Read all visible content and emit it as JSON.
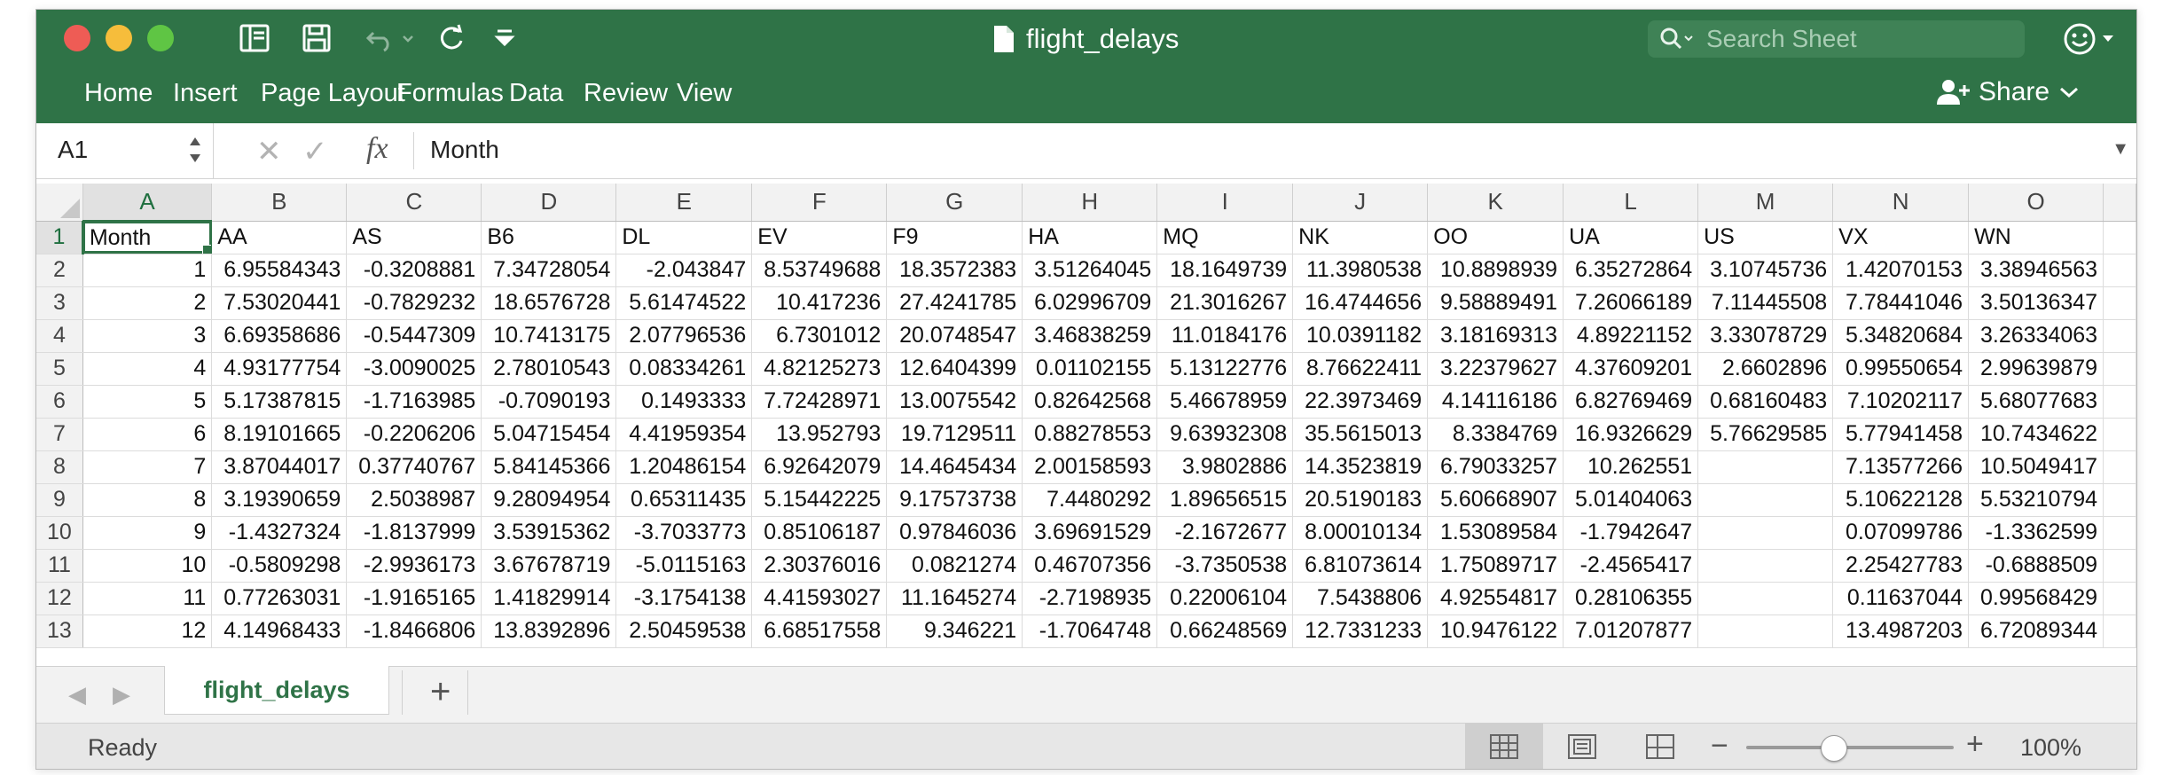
{
  "titlebar": {
    "doc_title": "flight_delays",
    "search_placeholder": "Search Sheet"
  },
  "ribbon": {
    "tabs": [
      "Home",
      "Insert",
      "Page Layout",
      "Formulas",
      "Data",
      "Review",
      "View"
    ],
    "share_label": "Share"
  },
  "formula_bar": {
    "cell_ref": "A1",
    "content": "Month"
  },
  "grid": {
    "columns": [
      "A",
      "B",
      "C",
      "D",
      "E",
      "F",
      "G",
      "H",
      "I",
      "J",
      "K",
      "L",
      "M",
      "N",
      "O"
    ],
    "rows": [
      {
        "num": "1",
        "cells": [
          "Month",
          "AA",
          "AS",
          "B6",
          "DL",
          "EV",
          "F9",
          "HA",
          "MQ",
          "NK",
          "OO",
          "UA",
          "US",
          "VX",
          "WN"
        ]
      },
      {
        "num": "2",
        "cells": [
          "1",
          "6.95584343",
          "-0.3208881",
          "7.34728054",
          "-2.043847",
          "8.53749688",
          "18.3572383",
          "3.51264045",
          "18.1649739",
          "11.3980538",
          "10.8898939",
          "6.35272864",
          "3.10745736",
          "1.42070153",
          "3.38946563"
        ]
      },
      {
        "num": "3",
        "cells": [
          "2",
          "7.53020441",
          "-0.7829232",
          "18.6576728",
          "5.61474522",
          "10.417236",
          "27.4241785",
          "6.02996709",
          "21.3016267",
          "16.4744656",
          "9.58889491",
          "7.26066189",
          "7.11445508",
          "7.78441046",
          "3.50136347"
        ]
      },
      {
        "num": "4",
        "cells": [
          "3",
          "6.69358686",
          "-0.5447309",
          "10.7413175",
          "2.07796536",
          "6.7301012",
          "20.0748547",
          "3.46838259",
          "11.0184176",
          "10.0391182",
          "3.18169313",
          "4.89221152",
          "3.33078729",
          "5.34820684",
          "3.26334063"
        ]
      },
      {
        "num": "5",
        "cells": [
          "4",
          "4.93177754",
          "-3.0090025",
          "2.78010543",
          "0.08334261",
          "4.82125273",
          "12.6404399",
          "0.01102155",
          "5.13122776",
          "8.76622411",
          "3.22379627",
          "4.37609201",
          "2.6602896",
          "0.99550654",
          "2.99639879"
        ]
      },
      {
        "num": "6",
        "cells": [
          "5",
          "5.17387815",
          "-1.7163985",
          "-0.7090193",
          "0.1493333",
          "7.72428971",
          "13.0075542",
          "0.82642568",
          "5.46678959",
          "22.3973469",
          "4.14116186",
          "6.82769469",
          "0.68160483",
          "7.10202117",
          "5.68077683"
        ]
      },
      {
        "num": "7",
        "cells": [
          "6",
          "8.19101665",
          "-0.2206206",
          "5.04715454",
          "4.41959354",
          "13.952793",
          "19.7129511",
          "0.88278553",
          "9.63932308",
          "35.5615013",
          "8.3384769",
          "16.9326629",
          "5.76629585",
          "5.77941458",
          "10.7434622"
        ]
      },
      {
        "num": "8",
        "cells": [
          "7",
          "3.87044017",
          "0.37740767",
          "5.84145366",
          "1.20486154",
          "6.92642079",
          "14.4645434",
          "2.00158593",
          "3.9802886",
          "14.3523819",
          "6.79033257",
          "10.262551",
          "",
          "7.13577266",
          "10.5049417"
        ]
      },
      {
        "num": "9",
        "cells": [
          "8",
          "3.19390659",
          "2.5038987",
          "9.28094954",
          "0.65311435",
          "5.15442225",
          "9.17573738",
          "7.4480292",
          "1.89656515",
          "20.5190183",
          "5.60668907",
          "5.01404063",
          "",
          "5.10622128",
          "5.53210794"
        ]
      },
      {
        "num": "10",
        "cells": [
          "9",
          "-1.4327324",
          "-1.8137999",
          "3.53915362",
          "-3.7033773",
          "0.85106187",
          "0.97846036",
          "3.69691529",
          "-2.1672677",
          "8.00010134",
          "1.53089584",
          "-1.7942647",
          "",
          "0.07099786",
          "-1.3362599"
        ]
      },
      {
        "num": "11",
        "cells": [
          "10",
          "-0.5809298",
          "-2.9936173",
          "3.67678719",
          "-5.0115163",
          "2.30376016",
          "0.0821274",
          "0.46707356",
          "-3.7350538",
          "6.81073614",
          "1.75089717",
          "-2.4565417",
          "",
          "2.25427783",
          "-0.6888509"
        ]
      },
      {
        "num": "12",
        "cells": [
          "11",
          "0.77263031",
          "-1.9165165",
          "1.41829914",
          "-3.1754138",
          "4.41593027",
          "11.1645274",
          "-2.7198935",
          "0.22006104",
          "7.5438806",
          "4.92554817",
          "0.28106355",
          "",
          "0.11637044",
          "0.99568429"
        ]
      },
      {
        "num": "13",
        "cells": [
          "12",
          "4.14968433",
          "-1.8466806",
          "13.8392896",
          "2.50459538",
          "6.68517558",
          "9.346221",
          "-1.7064748",
          "0.66248569",
          "12.7331233",
          "10.9476122",
          "7.01207877",
          "",
          "13.4987203",
          "6.72089344"
        ]
      }
    ]
  },
  "sheets": {
    "active_tab": "flight_delays",
    "add_label": "+"
  },
  "status": {
    "text": "Ready",
    "zoom_level": "100%",
    "zoom_fraction": 0.42
  },
  "colors": {
    "accent": "#2f7347"
  }
}
